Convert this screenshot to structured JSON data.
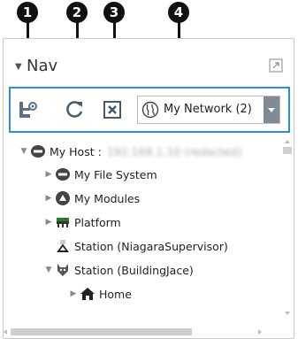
{
  "callouts": [
    "1",
    "2",
    "3",
    "4"
  ],
  "pane": {
    "title": "Nav",
    "collapse_icon": "triangle-down-icon",
    "maximize_icon": "maximize-icon"
  },
  "toolbar": {
    "tree_button_icon": "tree-view-icon",
    "refresh_button_icon": "refresh-icon",
    "close_button_icon": "close-box-icon",
    "network_select": {
      "icon": "globe-icon",
      "value": "My Network (2)"
    }
  },
  "tree": {
    "host_label": "My Host :",
    "host_address": "192.168.1.10 (redacted)",
    "items": [
      {
        "label": "My File System",
        "icon": "drive-icon"
      },
      {
        "label": "My Modules",
        "icon": "modules-icon"
      },
      {
        "label": "Platform",
        "icon": "platform-icon"
      },
      {
        "label": "Station (NiagaraSupervisor)",
        "icon": "station-icon"
      },
      {
        "label": "Station (BuildingJace)",
        "icon": "station-jace-icon"
      },
      {
        "label": "Home",
        "icon": "home-icon"
      }
    ]
  },
  "colors": {
    "highlight": "#2d8ed1",
    "dropdown": "#7f8a94"
  }
}
